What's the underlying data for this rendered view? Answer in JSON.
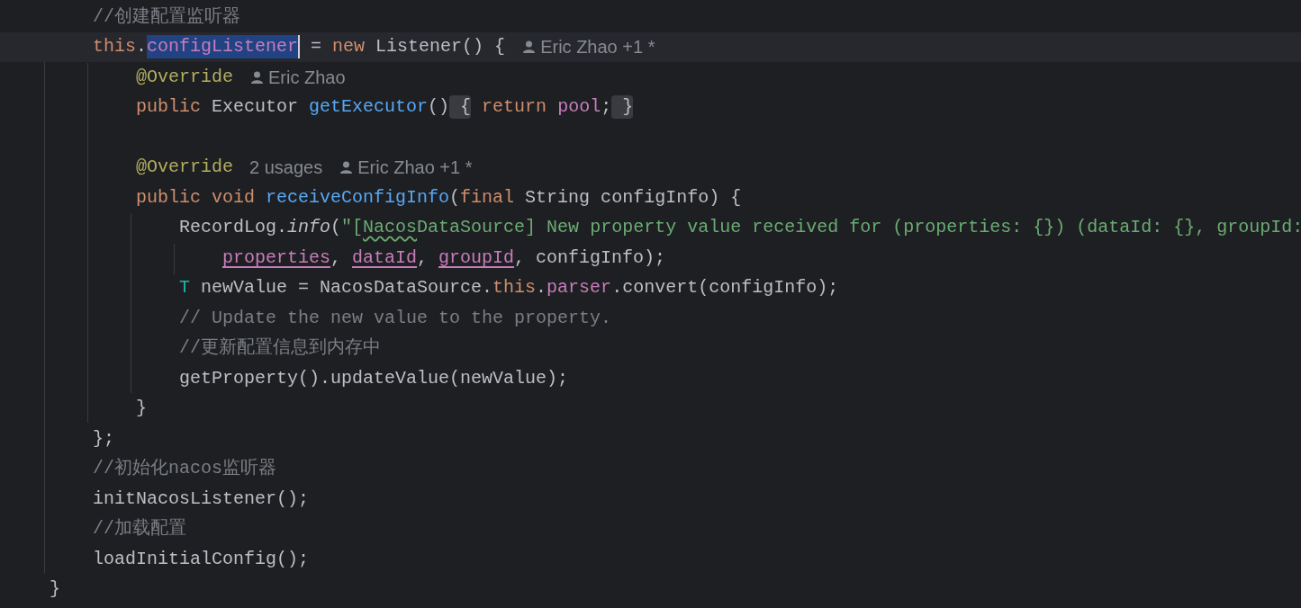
{
  "editor": {
    "lines": [
      {
        "current": false,
        "tokens": [
          {
            "kind": "comment",
            "text": "    //创建配置监听器"
          }
        ]
      },
      {
        "current": true,
        "tokens": [
          {
            "kind": "keyword",
            "text": "    this"
          },
          {
            "kind": "plain",
            "text": "."
          },
          {
            "kind": "selection",
            "text": "configListener",
            "caret": true
          },
          {
            "kind": "plain",
            "text": " = "
          },
          {
            "kind": "keyword",
            "text": "new "
          },
          {
            "kind": "plain",
            "text": "Listener() {"
          },
          {
            "kind": "author-hint",
            "text": "Eric Zhao +1 *"
          }
        ]
      },
      {
        "current": false,
        "tokens": [
          {
            "kind": "annotation",
            "text": "        @Override"
          },
          {
            "kind": "author-hint",
            "text": "Eric Zhao"
          }
        ]
      },
      {
        "current": false,
        "tokens": [
          {
            "kind": "keyword",
            "text": "        public "
          },
          {
            "kind": "plain",
            "text": "Executor "
          },
          {
            "kind": "method",
            "text": "getExecutor"
          },
          {
            "kind": "plain",
            "text": "()"
          },
          {
            "kind": "fold",
            "text": " {"
          },
          {
            "kind": "keyword",
            "text": " return "
          },
          {
            "kind": "field",
            "text": "pool"
          },
          {
            "kind": "plain",
            "text": ";"
          },
          {
            "kind": "fold",
            "text": " }"
          }
        ]
      },
      {
        "current": false
      },
      {
        "current": false,
        "tokens": [
          {
            "kind": "annotation",
            "text": "        @Override"
          },
          {
            "kind": "usage-hint",
            "text": "2 usages"
          },
          {
            "kind": "author-hint",
            "text": "Eric Zhao +1 *"
          }
        ]
      },
      {
        "current": false,
        "tokens": [
          {
            "kind": "keyword",
            "text": "        public void "
          },
          {
            "kind": "method",
            "text": "receiveConfigInfo"
          },
          {
            "kind": "plain",
            "text": "("
          },
          {
            "kind": "keyword",
            "text": "final "
          },
          {
            "kind": "plain",
            "text": "String configInfo) {"
          }
        ]
      },
      {
        "current": false,
        "tokens": [
          {
            "kind": "plain",
            "text": "            RecordLog."
          },
          {
            "kind": "italic",
            "text": "info"
          },
          {
            "kind": "plain",
            "text": "("
          },
          {
            "kind": "string",
            "text": "\"["
          },
          {
            "kind": "typo",
            "text": "Nacos"
          },
          {
            "kind": "string",
            "text": "DataSource] New property value received for (properties: {}) (dataId: {}, groupId:"
          }
        ]
      },
      {
        "current": false,
        "tokens": [
          {
            "kind": "field-ref",
            "text": "                properties"
          },
          {
            "kind": "plain",
            "text": ", "
          },
          {
            "kind": "field-ref",
            "text": "dataId"
          },
          {
            "kind": "plain",
            "text": ", "
          },
          {
            "kind": "field-ref",
            "text": "groupId"
          },
          {
            "kind": "plain",
            "text": ", configInfo);"
          }
        ]
      },
      {
        "current": false,
        "tokens": [
          {
            "kind": "type-param",
            "text": "            T "
          },
          {
            "kind": "plain",
            "text": "newValue = NacosDataSource."
          },
          {
            "kind": "keyword",
            "text": "this"
          },
          {
            "kind": "plain",
            "text": "."
          },
          {
            "kind": "field",
            "text": "parser"
          },
          {
            "kind": "plain",
            "text": ".convert(configInfo);"
          }
        ]
      },
      {
        "current": false,
        "tokens": [
          {
            "kind": "comment",
            "text": "            // Update the new value to the property."
          }
        ]
      },
      {
        "current": false,
        "tokens": [
          {
            "kind": "comment",
            "text": "            //更新配置信息到内存中"
          }
        ]
      },
      {
        "current": false,
        "tokens": [
          {
            "kind": "plain",
            "text": "            getProperty().updateValue(newValue);"
          }
        ]
      },
      {
        "current": false,
        "tokens": [
          {
            "kind": "plain",
            "text": "        }"
          }
        ]
      },
      {
        "current": false,
        "tokens": [
          {
            "kind": "plain",
            "text": "    };"
          }
        ]
      },
      {
        "current": false,
        "tokens": [
          {
            "kind": "comment",
            "text": "    //初始化nacos监听器"
          }
        ]
      },
      {
        "current": false,
        "tokens": [
          {
            "kind": "plain",
            "text": "    initNacosListener();"
          }
        ]
      },
      {
        "current": false,
        "tokens": [
          {
            "kind": "comment",
            "text": "    //加载配置"
          }
        ]
      },
      {
        "current": false,
        "tokens": [
          {
            "kind": "plain",
            "text": "    loadInitialConfig();"
          }
        ]
      },
      {
        "current": false,
        "tokens": [
          {
            "kind": "plain",
            "text": "}"
          }
        ]
      }
    ]
  }
}
